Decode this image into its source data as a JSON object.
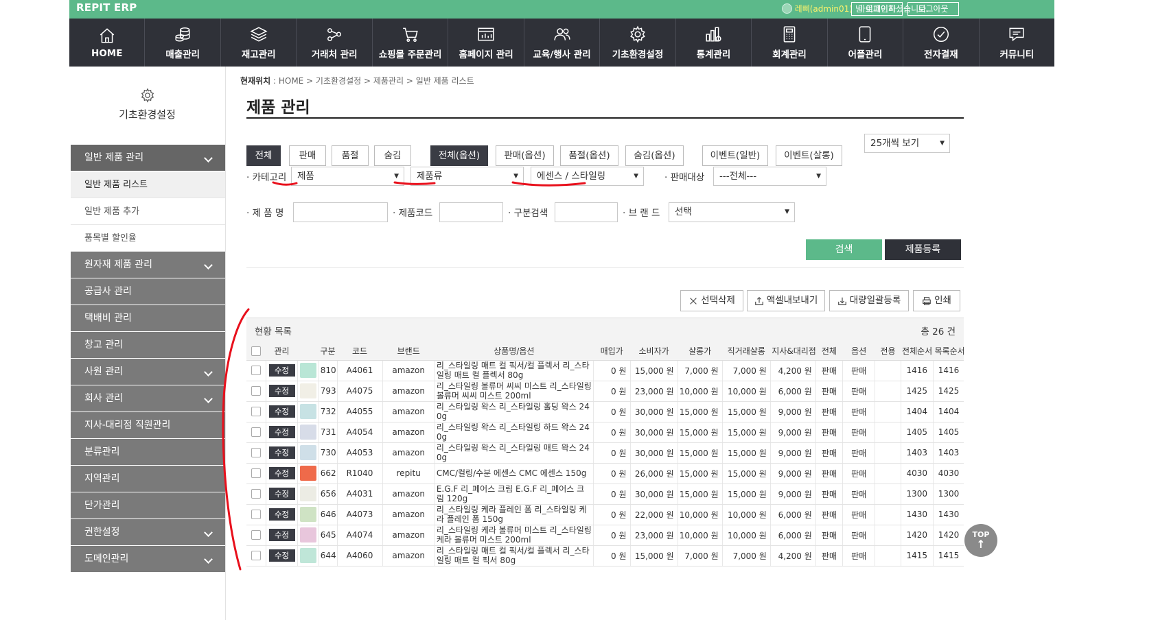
{
  "brand": "REPIT ERP",
  "topbar": {
    "login_user": "레삐(admin01)",
    "login_suffix": "님 로그인하셨습니다.",
    "mypage": "마이페이지",
    "logout": "로그아웃"
  },
  "nav": [
    {
      "label": "HOME",
      "icon": "home-icon"
    },
    {
      "label": "매출관리",
      "icon": "coins-icon"
    },
    {
      "label": "재고관리",
      "icon": "layers-icon"
    },
    {
      "label": "거래처 관리",
      "icon": "share-icon"
    },
    {
      "label": "쇼핑몰 주문관리",
      "icon": "cart-icon"
    },
    {
      "label": "홈페이지 관리",
      "icon": "chart-window-icon"
    },
    {
      "label": "교육/행사 관리",
      "icon": "people-icon"
    },
    {
      "label": "기초환경설정",
      "icon": "gear-icon"
    },
    {
      "label": "통계관리",
      "icon": "stats-icon"
    },
    {
      "label": "회계관리",
      "icon": "calculator-icon"
    },
    {
      "label": "어플관리",
      "icon": "tablet-icon"
    },
    {
      "label": "전자결재",
      "icon": "check-circle-icon"
    },
    {
      "label": "커뮤니티",
      "icon": "chat-icon"
    }
  ],
  "sidebar": {
    "title": "기초환경설정",
    "group1": "일반 제품 관리",
    "sub": [
      "일반 제품 리스트",
      "일반 제품 추가",
      "품목별 할인율"
    ],
    "groups": [
      "원자재 제품 관리",
      "공급사 관리",
      "택배비 관리",
      "창고 관리",
      "사원 관리",
      "회사 관리",
      "지사-대리점 직원관리",
      "분류관리",
      "지역관리",
      "단가관리",
      "권한설정",
      "도메인관리"
    ]
  },
  "breadcrumb": {
    "label": "현재위치",
    "path": " : HOME > 기초환경설정 > 제품관리 > 일반 제품 리스트"
  },
  "page_title": "제품 관리",
  "filters": {
    "tabs": [
      "전체",
      "판매",
      "품절",
      "숨김"
    ],
    "option_tabs": [
      "전체(옵션)",
      "판매(옵션)",
      "품절(옵션)",
      "숨김(옵션)"
    ],
    "event_tabs": [
      "이벤트(일반)",
      "이벤트(살롱)"
    ],
    "per_page": "25개씩 보기",
    "category_label": "· 카테고리",
    "category1": "제품",
    "category2": "제품류",
    "category3": "에센스 / 스타일링",
    "target_label": "· 판매대상",
    "target_value": "---전체---",
    "name_label": "· 제  품  명",
    "code_label": "· 제품코드",
    "type_label": "· 구분검색",
    "brand_label": "· 브  랜  드",
    "brand_value": "선택",
    "search": "검색",
    "register": "제품등록"
  },
  "actions": {
    "delete": "선택삭제",
    "excel": "액셀내보내기",
    "bulk": "대량일괄등록",
    "print": "인쇄"
  },
  "list": {
    "title": "현황 목록",
    "count": "총 26 건",
    "edit_label": "수정",
    "headers": [
      "관리",
      "구분",
      "코드",
      "브랜드",
      "상품명/옵션",
      "매입가",
      "소비자가",
      "살롱가",
      "직거래살롱",
      "지사&대리점",
      "전체",
      "옵션",
      "전용",
      "전체순서",
      "목록순서"
    ],
    "rows": [
      {
        "no": "810",
        "code": "A4061",
        "brand": "amazon",
        "name": "리_스타일링 매트 컬 픽서/컬 플렉서 리_스타일링 매트 컬 플렉서 80g",
        "buy": "0 원",
        "consumer": "15,000 원",
        "salon": "7,000 원",
        "direct": "7,000 원",
        "branch": "4,200 원",
        "all": "판매",
        "opt": "판매",
        "ex": "",
        "ord1": "1416",
        "ord2": "1416",
        "thumb": "#b9e6d6"
      },
      {
        "no": "793",
        "code": "A4075",
        "brand": "amazon",
        "name": "리_스타일링 볼류머 씨씨 미스트 리_스타일링 볼류머 씨씨 미스트 200ml",
        "buy": "0 원",
        "consumer": "23,000 원",
        "salon": "10,000 원",
        "direct": "10,000 원",
        "branch": "6,000 원",
        "all": "판매",
        "opt": "판매",
        "ex": "",
        "ord1": "1425",
        "ord2": "1425",
        "thumb": "#f1efe6"
      },
      {
        "no": "732",
        "code": "A4055",
        "brand": "amazon",
        "name": "리_스타일링 왁스 리_스타일링 홀딩 왁스 240g",
        "buy": "0 원",
        "consumer": "30,000 원",
        "salon": "15,000 원",
        "direct": "15,000 원",
        "branch": "9,000 원",
        "all": "판매",
        "opt": "판매",
        "ex": "",
        "ord1": "1404",
        "ord2": "1404",
        "thumb": "#c7e2e4"
      },
      {
        "no": "731",
        "code": "A4054",
        "brand": "amazon",
        "name": "리_스타일링 왁스 리_스타일링 하드 왁스 240g",
        "buy": "0 원",
        "consumer": "30,000 원",
        "salon": "15,000 원",
        "direct": "15,000 원",
        "branch": "9,000 원",
        "all": "판매",
        "opt": "판매",
        "ex": "",
        "ord1": "1405",
        "ord2": "1405",
        "thumb": "#d7dce8"
      },
      {
        "no": "730",
        "code": "A4053",
        "brand": "amazon",
        "name": "리_스타일링 왁스 리_스타일링 매트 왁스 240g",
        "buy": "0 원",
        "consumer": "30,000 원",
        "salon": "15,000 원",
        "direct": "15,000 원",
        "branch": "9,000 원",
        "all": "판매",
        "opt": "판매",
        "ex": "",
        "ord1": "1403",
        "ord2": "1403",
        "thumb": "#cfdfe8"
      },
      {
        "no": "662",
        "code": "R1040",
        "brand": "repitu",
        "name": "CMC/컬링/수분 에센스 CMC 에센스 150g",
        "buy": "0 원",
        "consumer": "26,000 원",
        "salon": "15,000 원",
        "direct": "15,000 원",
        "branch": "9,000 원",
        "all": "판매",
        "opt": "판매",
        "ex": "",
        "ord1": "4030",
        "ord2": "4030",
        "thumb": "#ef6a4a"
      },
      {
        "no": "656",
        "code": "A4031",
        "brand": "amazon",
        "name": "E.G.F 리_페어스 크림 E.G.F 리_페어스 크림 120g",
        "buy": "0 원",
        "consumer": "30,000 원",
        "salon": "15,000 원",
        "direct": "15,000 원",
        "branch": "9,000 원",
        "all": "판매",
        "opt": "판매",
        "ex": "",
        "ord1": "1300",
        "ord2": "1300",
        "thumb": "#ecece4"
      },
      {
        "no": "646",
        "code": "A4073",
        "brand": "amazon",
        "name": "리_스타일링 케라 플레인 폼 리_스타일링 케라 플레인 폼 150g",
        "buy": "0 원",
        "consumer": "22,000 원",
        "salon": "10,000 원",
        "direct": "10,000 원",
        "branch": "6,000 원",
        "all": "판매",
        "opt": "판매",
        "ex": "",
        "ord1": "1430",
        "ord2": "1430",
        "thumb": "#cfe3c4"
      },
      {
        "no": "645",
        "code": "A4074",
        "brand": "amazon",
        "name": "리_스타일링 케라 볼류머 미스트 리_스타일링 케라 볼류머 미스트 200ml",
        "buy": "0 원",
        "consumer": "23,000 원",
        "salon": "10,000 원",
        "direct": "10,000 원",
        "branch": "6,000 원",
        "all": "판매",
        "opt": "판매",
        "ex": "",
        "ord1": "1420",
        "ord2": "1420",
        "thumb": "#e8c6dc"
      },
      {
        "no": "644",
        "code": "A4060",
        "brand": "amazon",
        "name": "리_스타일링 매트 컬 픽서/컬 플렉서 리_스타일링 매트 컬 픽서 80g",
        "buy": "0 원",
        "consumer": "15,000 원",
        "salon": "7,000 원",
        "direct": "7,000 원",
        "branch": "4,200 원",
        "all": "판매",
        "opt": "판매",
        "ex": "",
        "ord1": "1415",
        "ord2": "1415",
        "thumb": "#bfe6d8"
      }
    ]
  },
  "top_button": "TOP"
}
